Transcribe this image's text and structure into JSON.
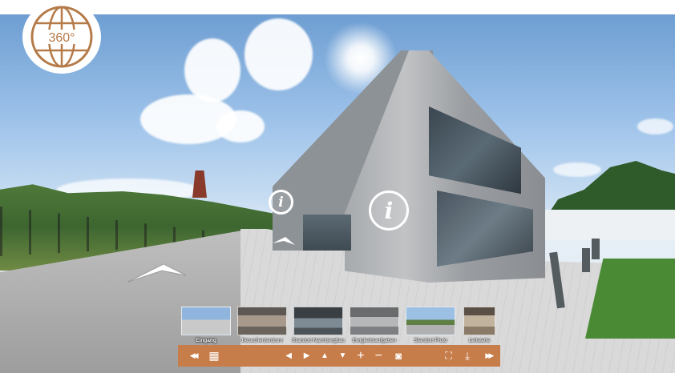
{
  "badge": {
    "text": "360°",
    "icon": "globe-icon",
    "color": "#b47a48"
  },
  "hotspots": {
    "info_icon": "i"
  },
  "thumbnails": [
    {
      "label": "Eingang",
      "active": true
    },
    {
      "label": "Besucherzentrum",
      "active": false
    },
    {
      "label": "Standort Nachbergbau",
      "active": false
    },
    {
      "label": "Ewigkeitsaufgaben",
      "active": false
    },
    {
      "label": "Standort Pluto",
      "active": false
    },
    {
      "label": "Leitwarte",
      "active": false
    }
  ],
  "toolbar": {
    "color": "#c77d4a",
    "buttons": [
      {
        "name": "hide-thumbnails-button",
        "icon": "double-left-icon",
        "glyph": "◀◀"
      },
      {
        "name": "thumbnail-grid-button",
        "icon": "grid-icon",
        "glyph": "▦"
      },
      {
        "name": "pan-left-button",
        "icon": "arrow-left-icon",
        "glyph": "◀"
      },
      {
        "name": "pan-right-button",
        "icon": "arrow-right-icon",
        "glyph": "▶"
      },
      {
        "name": "pan-up-button",
        "icon": "arrow-up-icon",
        "glyph": "▲"
      },
      {
        "name": "pan-down-button",
        "icon": "arrow-down-icon",
        "glyph": "▼"
      },
      {
        "name": "zoom-in-button",
        "icon": "plus-icon",
        "glyph": "+"
      },
      {
        "name": "zoom-out-button",
        "icon": "minus-icon",
        "glyph": "−"
      },
      {
        "name": "vr-mode-button",
        "icon": "vr-goggles-icon",
        "glyph": "◙"
      },
      {
        "name": "fullscreen-button",
        "icon": "fullscreen-icon",
        "glyph": "⛶"
      },
      {
        "name": "autorotate-button",
        "icon": "download-arrow-icon",
        "glyph": "⤓"
      },
      {
        "name": "next-scene-button",
        "icon": "double-right-icon",
        "glyph": "▶▶"
      }
    ]
  }
}
